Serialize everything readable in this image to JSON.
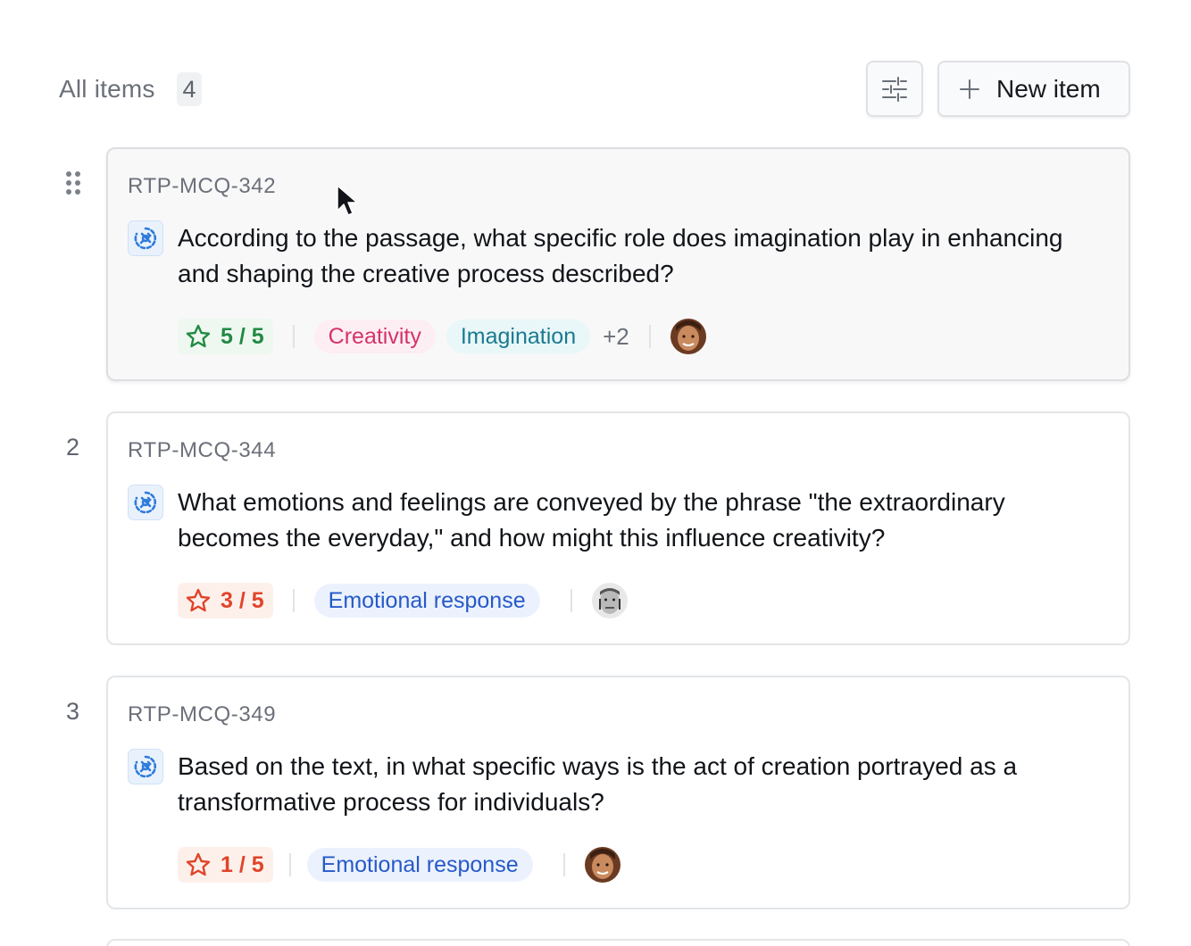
{
  "header": {
    "title": "All items",
    "count": "4",
    "new_item_label": "New item"
  },
  "colors": {
    "accent_blue": "#2f7bdc",
    "rating_good": "#218a43",
    "rating_bad": "#e0442a"
  },
  "items": [
    {
      "handle": "drag",
      "id": "RTP-MCQ-342",
      "question": "According to the passage, what specific role does imagination play in enhancing and shaping the creative process described?",
      "rating": "5 / 5",
      "rating_level": 1.0,
      "tags": [
        "Creativity",
        "Imagination"
      ],
      "more_tags": "+2",
      "avatar": "avatar-woman-icon"
    },
    {
      "number": "2",
      "id": "RTP-MCQ-344",
      "question": "What emotions and feelings are conveyed by the phrase \"the extraordinary becomes the everyday,\" and how might this influence creativity?",
      "rating": "3 / 5",
      "rating_level": 0.6,
      "tags": [
        "Emotional response"
      ],
      "avatar": "avatar-man-icon"
    },
    {
      "number": "3",
      "id": "RTP-MCQ-349",
      "question": "Based on the text, in what specific ways is the act of creation portrayed as a transformative process for individuals?",
      "rating": "1 / 5",
      "rating_level": 0.2,
      "tags": [
        "Emotional response"
      ],
      "avatar": "avatar-woman-icon"
    }
  ]
}
